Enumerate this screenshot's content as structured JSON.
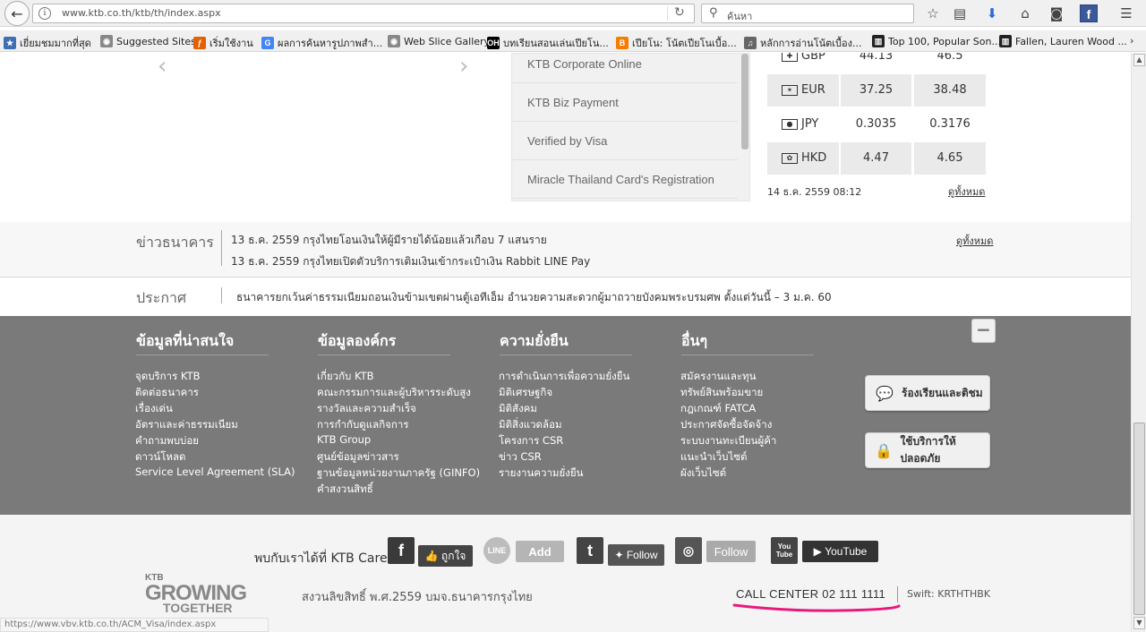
{
  "browser": {
    "url": "www.ktb.co.th/ktb/th/index.aspx",
    "search_placeholder": "ค้นหา",
    "back_label": "←",
    "icons": [
      "star-icon",
      "reading-list-icon",
      "download-icon",
      "home-icon",
      "pocket-icon",
      "facebook-icon",
      "menu-icon"
    ]
  },
  "bookmarks": [
    {
      "label": "เยี่ยมชมมากที่สุด",
      "icon": "folder-icon",
      "color": "#3d6fb5"
    },
    {
      "label": "Suggested Sites",
      "icon": "globe-icon",
      "color": "#888888"
    },
    {
      "label": "เริ่มใช้งาน",
      "icon": "firefox-icon",
      "color": "#e66000"
    },
    {
      "label": "ผลการค้นหารูปภาพสำ...",
      "icon": "google-icon",
      "color": "#4285f4"
    },
    {
      "label": "Web Slice Gallery",
      "icon": "globe-icon",
      "color": "#888888"
    },
    {
      "label": "บทเรียนสอนเล่นเปียโน...",
      "icon": "oh-icon",
      "color": "#000000"
    },
    {
      "label": "เปียโน: โน้ตเปียโนเบื้อ...",
      "icon": "blogger-icon",
      "color": "#f57d00"
    },
    {
      "label": "หลักการอ่านโน้ตเบื้อง...",
      "icon": "sheet-icon",
      "color": "#666666"
    },
    {
      "label": "Top 100, Popular Son...",
      "icon": "piano-icon",
      "color": "#222222"
    },
    {
      "label": "Fallen, Lauren Wood ...",
      "icon": "piano-icon",
      "color": "#222222"
    }
  ],
  "services": [
    "KTB Corporate Online",
    "KTB Biz Payment",
    "Verified by Visa",
    "Miracle Thailand Card's Registration"
  ],
  "fx": {
    "rows": [
      {
        "code": "GBP",
        "buy": "44.13",
        "sell": "46.5",
        "flag": "🇬🇧"
      },
      {
        "code": "EUR",
        "buy": "37.25",
        "sell": "38.48",
        "flag": "✶"
      },
      {
        "code": "JPY",
        "buy": "0.3035",
        "sell": "0.3176",
        "flag": "●"
      },
      {
        "code": "HKD",
        "buy": "4.47",
        "sell": "4.65",
        "flag": "✿"
      }
    ],
    "date": "14 ธ.ค. 2559 08:12",
    "view_all": "ดูทั้งหมด"
  },
  "news": {
    "title": "ข่าวธนาคาร",
    "items": [
      "13 ธ.ค. 2559 กรุงไทยโอนเงินให้ผู้มีรายได้น้อยแล้วเกือบ 7 แสนราย",
      "13 ธ.ค. 2559 กรุงไทยเปิดตัวบริการเติมเงินเข้ากระเป๋าเงิน Rabbit LINE Pay"
    ],
    "view_all": "ดูทั้งหมด"
  },
  "announcement": {
    "title": "ประกาศ",
    "text": "ธนาคารยกเว้นค่าธรรมเนียมถอนเงินข้ามเขตผ่านตู้เอทีเอ็ม อำนวยความสะดวกผู้มาถวายบังคมพระบรมศพ ตั้งแต่วันนี้ – 3 ม.ค. 60"
  },
  "footer": {
    "columns": [
      {
        "title": "ข้อมูลที่น่าสนใจ",
        "links": [
          "จุดบริการ KTB",
          "ติดต่อธนาคาร",
          "เรื่องเด่น",
          "อัตราและค่าธรรมเนียม",
          "คำถามพบบ่อย",
          "ดาวน์โหลด",
          "Service Level Agreement (SLA)"
        ]
      },
      {
        "title": "ข้อมูลองค์กร",
        "links": [
          "เกี่ยวกับ KTB",
          "คณะกรรมการและผู้บริหารระดับสูง",
          "รางวัลและความสำเร็จ",
          "การกำกับดูแลกิจการ",
          "KTB Group",
          "ศูนย์ข้อมูลข่าวสาร",
          "ฐานข้อมูลหน่วยงานภาครัฐ (GINFO)",
          "คำสงวนสิทธิ์"
        ]
      },
      {
        "title": "ความยั่งยืน",
        "links": [
          "การดำเนินการเพื่อความยั่งยืน",
          "มิติเศรษฐกิจ",
          "มิติสังคม",
          "มิติสิ่งแวดล้อม",
          "โครงการ CSR",
          "ข่าว CSR",
          "รายงานความยั่งยืน"
        ]
      },
      {
        "title": "อื่นๆ",
        "links": [
          "สมัครงานและทุน",
          "ทรัพย์สินพร้อมขาย",
          "กฎเกณฑ์ FATCA",
          "ประกาศจัดซื้อจัดจ้าง",
          "ระบบงานทะเบียนผู้ค้า",
          "แนะนำเว็บไซต์",
          "ผังเว็บไซต์"
        ]
      }
    ],
    "collapse_label": "−",
    "complaint_label": "ร้องเรียนและติชม",
    "safety_label": "ใช้บริการให้ปลอดภัย"
  },
  "social": {
    "care_label": "พบกับเราได้ที่ KTB Care",
    "facebook_icon_text": "f",
    "facebook_like": "ถูกใจ",
    "line_icon_text": "LINE",
    "line_add": "Add",
    "twitter_icon_text": "t",
    "twitter_follow": "Follow",
    "instagram_follow": "Follow",
    "youtube_icon_text": "You Tube",
    "youtube_label": "YouTube"
  },
  "bottom": {
    "logo_ktb": "KTB",
    "logo_growing": "GROWING",
    "logo_together": "TOGETHER",
    "copyright": "สงวนลิขสิทธิ์ พ.ศ.2559 บมจ.ธนาคารกรุงไทย",
    "callcenter": "CALL CENTER 02 111 1111",
    "swift": "Swift: KRTHTHBK",
    "underline_color": "#e8197d"
  },
  "status_url": "https://www.vbv.ktb.co.th/ACM_Visa/index.aspx"
}
